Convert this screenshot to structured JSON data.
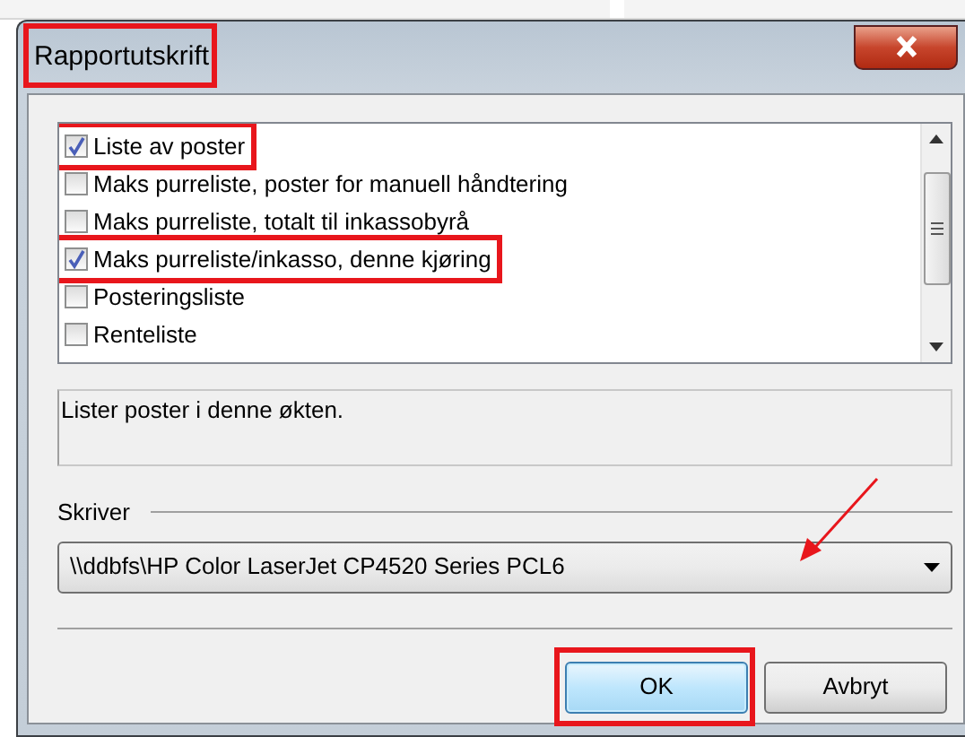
{
  "window": {
    "title": "Rapportutskrift",
    "title_highlighted": true
  },
  "reports": {
    "items": [
      {
        "label": "Liste av poster",
        "checked": true,
        "highlighted": true
      },
      {
        "label": "Maks purreliste, poster for manuell håndtering",
        "checked": false,
        "highlighted": false
      },
      {
        "label": "Maks purreliste, totalt til inkassobyrå",
        "checked": false,
        "highlighted": false
      },
      {
        "label": "Maks purreliste/inkasso, denne kjøring",
        "checked": true,
        "highlighted": true
      },
      {
        "label": "Posteringsliste",
        "checked": false,
        "highlighted": false
      },
      {
        "label": "Renteliste",
        "checked": false,
        "highlighted": false
      }
    ]
  },
  "description": "Lister poster i denne økten.",
  "printer": {
    "label": "Skriver",
    "value": "\\\\ddbfs\\HP Color LaserJet CP4520 Series PCL6",
    "annotation_arrow": true
  },
  "buttons": [
    {
      "label": "OK",
      "kind": "default",
      "highlighted": true
    },
    {
      "label": "Avbryt",
      "kind": "normal",
      "highlighted": false
    }
  ]
}
